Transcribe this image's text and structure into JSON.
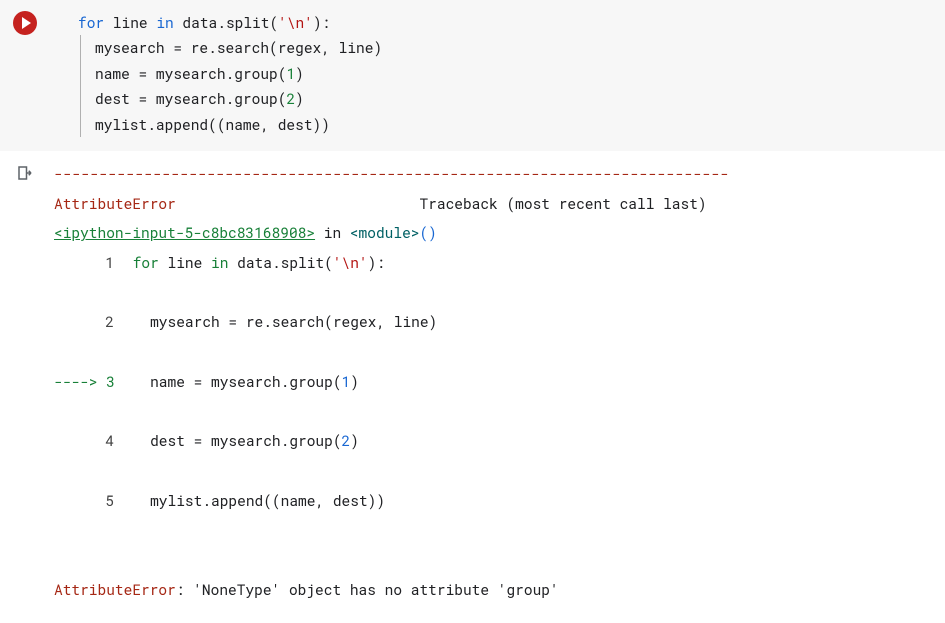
{
  "input": {
    "code": {
      "l1a": "for",
      "l1b": " line ",
      "l1c": "in",
      "l1d": " data.split(",
      "l1e": "'\\n'",
      "l1f": "):",
      "l2": "mysearch = re.search(regex, line)",
      "l3a": "name = mysearch.group(",
      "l3b": "1",
      "l3c": ")",
      "l4a": "dest = mysearch.group(",
      "l4b": "2",
      "l4c": ")",
      "l5": "mylist.append((name, dest))"
    }
  },
  "output": {
    "dashes": "---------------------------------------------------------------------------",
    "error_name": "AttributeError",
    "traceback_label": "Traceback (most recent call last)",
    "source_ref": "<ipython-input-5-c8bc83168908>",
    "in_word": " in ",
    "module_ref": "<module>",
    "paren": "()",
    "lines": {
      "n1": "1",
      "n2": "2",
      "arrow3": "----> 3",
      "n4": "4",
      "n5": "5",
      "c1a": " for",
      "c1b": " line ",
      "c1c": "in",
      "c1d": " data.split(",
      "c1e": "'\\n'",
      "c1f": "):",
      "c2": "   mysearch = re.search(regex, line)",
      "c3a": "   name = mysearch.group(",
      "c3b": "1",
      "c3c": ")",
      "c4a": "   dest = mysearch.group(",
      "c4b": "2",
      "c4c": ")",
      "c5": "   mylist.append((name, dest))"
    },
    "final_a": "AttributeError",
    "final_b": ": 'NoneType' object has no attribute 'group'"
  }
}
